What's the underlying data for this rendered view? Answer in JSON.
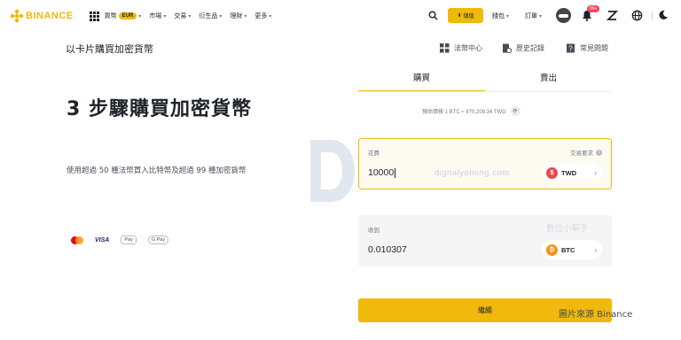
{
  "brand": {
    "name": "BINANCE",
    "color": "#f0b90b"
  },
  "nav": {
    "items": [
      {
        "label": "買幣",
        "badge": "EUR"
      },
      {
        "label": "市場"
      },
      {
        "label": "交易"
      },
      {
        "label": "衍生品"
      },
      {
        "label": "理財"
      },
      {
        "label": "更多"
      }
    ]
  },
  "header_right": {
    "deposit_label": "儲值",
    "wallet_label": "錢包",
    "orders_label": "訂單",
    "notification_count": "99+"
  },
  "page": {
    "title": "以卡片購買加密貨幣",
    "links": [
      {
        "label": "法幣中心",
        "icon": "grid-icon"
      },
      {
        "label": "歷史記錄",
        "icon": "history-icon"
      },
      {
        "label": "常見問題",
        "icon": "faq-icon"
      }
    ]
  },
  "hero": {
    "title": "3 步驟購買加密貨幣",
    "subtitle": "使用超過 50 種法幣買入比特幣及超過 99 種加密貨幣"
  },
  "payment_methods": [
    "mastercard-icon",
    "VISA",
    "Pay",
    "G Pay"
  ],
  "trade": {
    "tabs": [
      {
        "label": "購買",
        "active": true
      },
      {
        "label": "賣出",
        "active": false
      }
    ],
    "reference_price": "預估價格 1 BTC ≈ 970,209.34 TWD",
    "spend": {
      "label": "花費",
      "right_label": "交易要求",
      "value": "10000",
      "currency": "TWD"
    },
    "receive": {
      "label": "收到",
      "value": "0.010307",
      "currency": "BTC"
    },
    "continue_label": "繼續"
  },
  "watermarks": {
    "site": "digitalyoming.com",
    "site_cn": "數位小幫手",
    "credit": "圖片來源 Binance"
  }
}
